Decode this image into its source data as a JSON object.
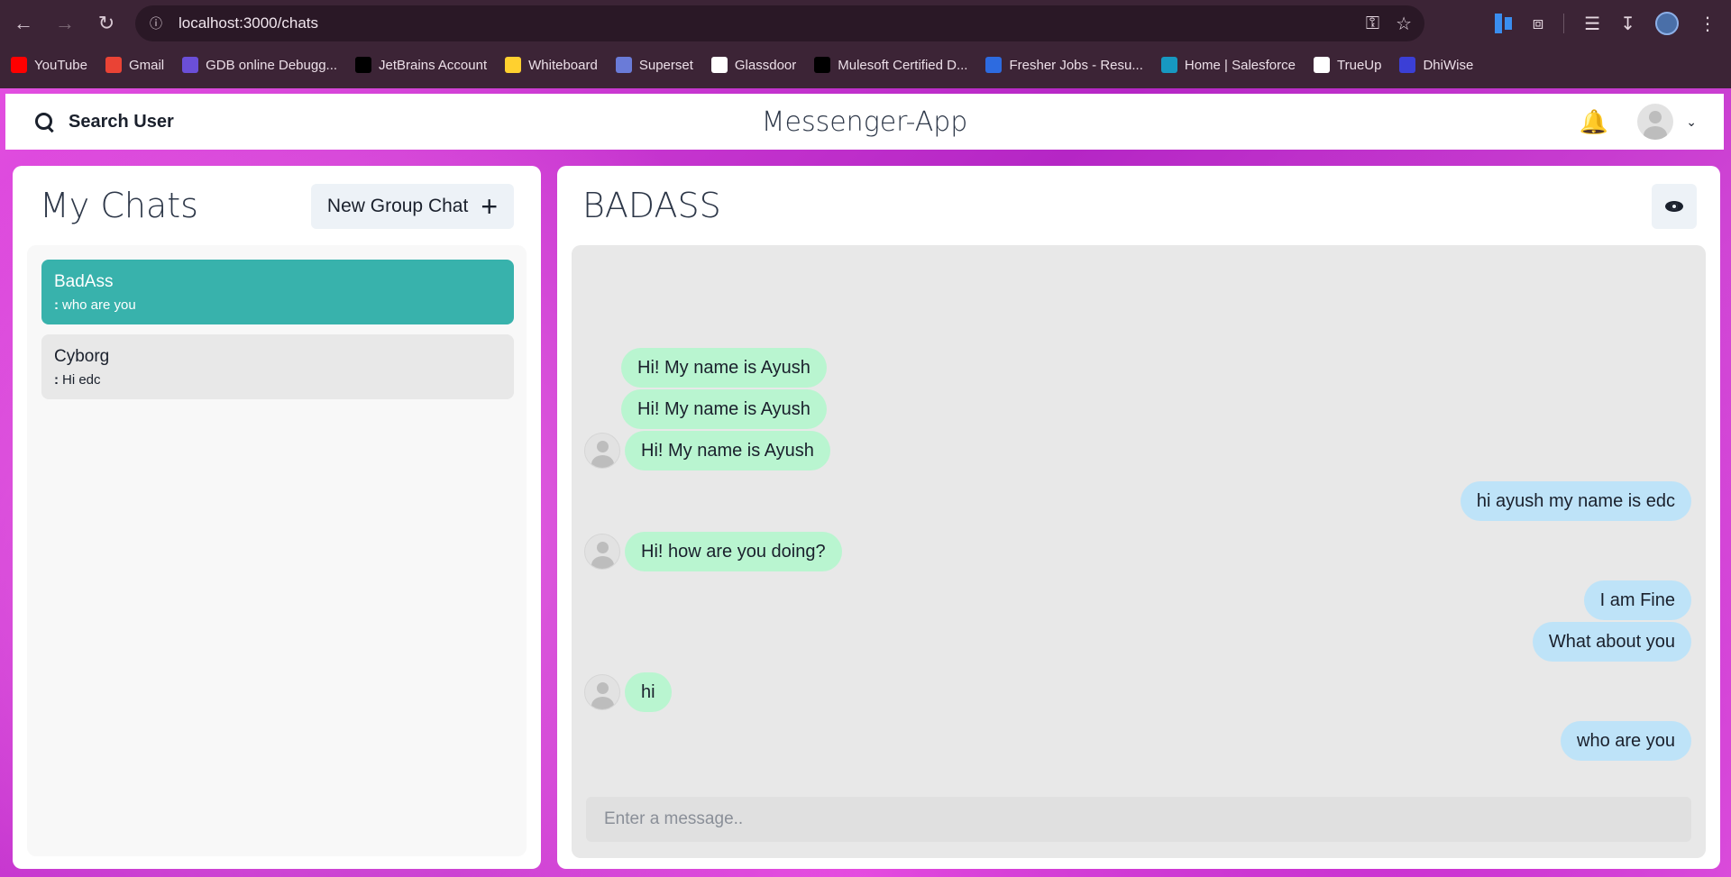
{
  "browser": {
    "url": "localhost:3000/chats",
    "bookmarks": [
      {
        "label": "YouTube",
        "icon": "youtube-icon",
        "color": "#ff0000"
      },
      {
        "label": "Gmail",
        "icon": "gmail-icon",
        "color": "#ea4335"
      },
      {
        "label": "GDB online Debugg...",
        "icon": "gdb-icon",
        "color": "#6b4fd8"
      },
      {
        "label": "JetBrains Account",
        "icon": "jetbrains-icon",
        "color": "#000000"
      },
      {
        "label": "Whiteboard",
        "icon": "whiteboard-icon",
        "color": "#ffd02f"
      },
      {
        "label": "Superset",
        "icon": "superset-icon",
        "color": "#6a7bd8"
      },
      {
        "label": "Glassdoor",
        "icon": "glassdoor-icon",
        "color": "#ffffff"
      },
      {
        "label": "Mulesoft Certified D...",
        "icon": "medium-icon",
        "color": "#000000"
      },
      {
        "label": "Fresher Jobs - Resu...",
        "icon": "fresher-jobs-icon",
        "color": "#2d6be0"
      },
      {
        "label": "Home | Salesforce",
        "icon": "salesforce-icon",
        "color": "#1798c1"
      },
      {
        "label": "TrueUp",
        "icon": "trueup-icon",
        "color": "#ffffff"
      },
      {
        "label": "DhiWise",
        "icon": "dhiwise-icon",
        "color": "#3b3fd6"
      }
    ]
  },
  "header": {
    "search_label": "Search User",
    "app_title": "Messenger-App"
  },
  "sidebar": {
    "title": "My Chats",
    "new_group_label": "New Group Chat",
    "chats": [
      {
        "name": "BadAss",
        "last_prefix": ":",
        "last_message": "who are you",
        "active": true
      },
      {
        "name": "Cyborg",
        "last_prefix": ":",
        "last_message": "Hi edc",
        "active": false
      }
    ]
  },
  "chat": {
    "title": "BADASS",
    "input_placeholder": "Enter a message..",
    "messages": [
      {
        "text": "Hi! My name is Ayush",
        "from": "other",
        "show_avatar": false
      },
      {
        "text": "Hi! My name is Ayush",
        "from": "other",
        "show_avatar": false
      },
      {
        "text": "Hi! My name is Ayush",
        "from": "other",
        "show_avatar": true
      },
      {
        "text": "hi ayush my name is edc",
        "from": "me"
      },
      {
        "text": "Hi! how are you doing?",
        "from": "other",
        "show_avatar": true
      },
      {
        "text": "I am Fine",
        "from": "me"
      },
      {
        "text": "What about you",
        "from": "me"
      },
      {
        "text": "hi",
        "from": "other",
        "show_avatar": true
      },
      {
        "text": "who are you",
        "from": "me"
      }
    ]
  },
  "colors": {
    "active_chat": "#38b2ac",
    "incoming_bubble": "#b9f5d0",
    "outgoing_bubble": "#bee3f8"
  }
}
